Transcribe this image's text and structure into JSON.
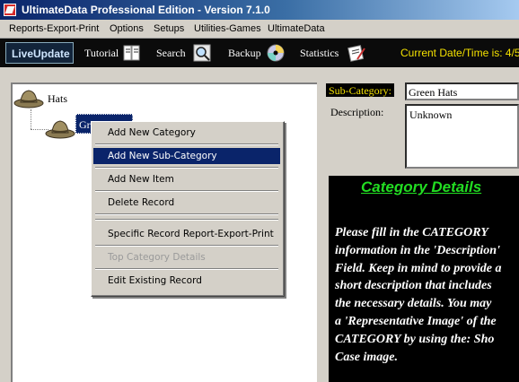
{
  "window": {
    "title": "UltimateData Professional Edition - Version 7.1.0"
  },
  "menu": {
    "items": [
      "Reports-Export-Print",
      "Options",
      "Setups",
      "Utilities-Games",
      "UltimateData"
    ]
  },
  "toolbar": {
    "liveupdate": "LiveUpdate",
    "tutorial": "Tutorial",
    "search": "Search",
    "backup": "Backup",
    "statistics": "Statistics",
    "datetime": "Current Date/Time is: 4/5"
  },
  "tree": {
    "root": "Hats",
    "child": "Gr"
  },
  "context_menu": {
    "items": [
      "Add New Category",
      "Add New Sub-Category",
      "Add New Item",
      "Delete Record",
      "Specific Record Report-Export-Print",
      "Top Category Details",
      "Edit Existing Record"
    ]
  },
  "form": {
    "subcat_label": "Sub-Category:",
    "subcat_value": "Green Hats",
    "desc_label": "Description:",
    "desc_value": "Unknown"
  },
  "details": {
    "title": "Category Details",
    "body": "Please fill in the CATEGORY\ninformation in the 'Description'\nField. Keep in mind to provide a\nshort description that includes\nthe necessary details. You may\na 'Representative Image' of the\nCATEGORY by using the: Sho\nCase image."
  },
  "colors": {
    "title_blue": "#0a246a",
    "toolbar_black": "#0b0b0b",
    "date_yellow": "#f4e100",
    "details_green": "#22dd22"
  }
}
